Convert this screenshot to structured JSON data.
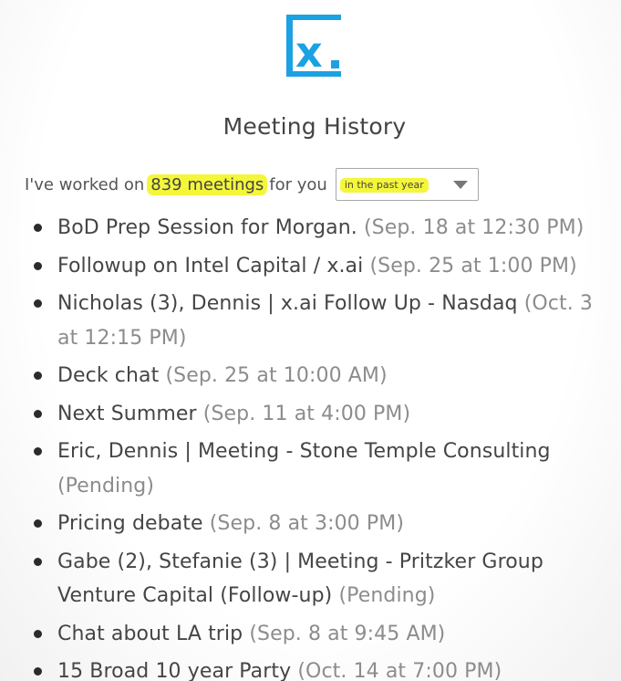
{
  "logo": {
    "text": "x.",
    "icon": "xai-logo-icon",
    "color": "#1ca1e2"
  },
  "page_title": "Meeting History",
  "summary": {
    "prefix": "I've worked on",
    "count": "839 meetings",
    "suffix": "for you"
  },
  "period_select": {
    "selected": "in the past year",
    "icon": "chevron-down-icon"
  },
  "highlight_color": "#f4f63a",
  "meetings": [
    {
      "title": "BoD Prep Session for Morgan.",
      "when": "(Sep. 18 at 12:30 PM)"
    },
    {
      "title": "Followup on Intel Capital / x.ai",
      "when": "(Sep. 25 at 1:00 PM)"
    },
    {
      "title": "Nicholas (3), Dennis | x.ai Follow Up - Nasdaq",
      "when": "(Oct. 3 at 12:15 PM)"
    },
    {
      "title": "Deck chat",
      "when": "(Sep. 25 at 10:00 AM)"
    },
    {
      "title": "Next Summer",
      "when": "(Sep. 11 at 4:00 PM)"
    },
    {
      "title": "Eric, Dennis | Meeting - Stone Temple Consulting",
      "when": "(Pending)"
    },
    {
      "title": "Pricing debate",
      "when": "(Sep. 8 at 3:00 PM)"
    },
    {
      "title": "Gabe (2), Stefanie (3) | Meeting - Pritzker Group Venture Capital (Follow-up)",
      "when": "(Pending)"
    },
    {
      "title": "Chat about LA trip",
      "when": "(Sep. 8 at 9:45 AM)"
    },
    {
      "title": "15 Broad 10 year Party",
      "when": "(Oct. 14 at 7:00 PM)"
    }
  ]
}
